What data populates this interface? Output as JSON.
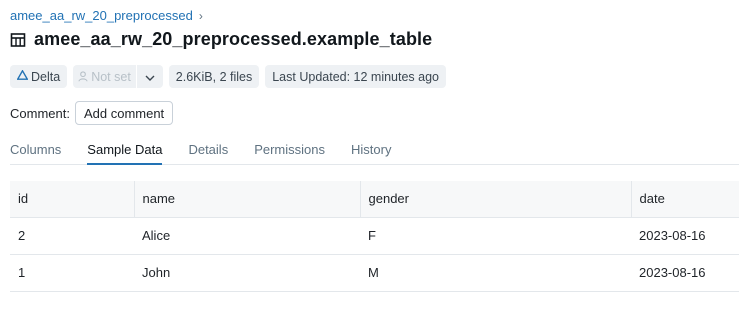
{
  "breadcrumb": {
    "schema": "amee_aa_rw_20_preprocessed",
    "chevron": "›"
  },
  "title": "amee_aa_rw_20_preprocessed.example_table",
  "pills": {
    "format": "Delta",
    "format_icon": "delta-icon",
    "owner_placeholder": "Not set",
    "owner_icon": "user-icon",
    "size": "2.6KiB, 2 files",
    "last_updated": "Last Updated: 12 minutes ago"
  },
  "comment": {
    "label": "Comment:",
    "button": "Add comment"
  },
  "tabs": [
    {
      "label": "Columns",
      "active": false
    },
    {
      "label": "Sample Data",
      "active": true
    },
    {
      "label": "Details",
      "active": false
    },
    {
      "label": "Permissions",
      "active": false
    },
    {
      "label": "History",
      "active": false
    }
  ],
  "table": {
    "columns": [
      "id",
      "name",
      "gender",
      "date"
    ],
    "rows": [
      [
        "2",
        "Alice",
        "F",
        "2023-08-16"
      ],
      [
        "1",
        "John",
        "M",
        "2023-08-16"
      ]
    ]
  },
  "colors": {
    "link": "#2272b4",
    "pill_bg": "#eef1f4",
    "muted": "#5f7281"
  }
}
